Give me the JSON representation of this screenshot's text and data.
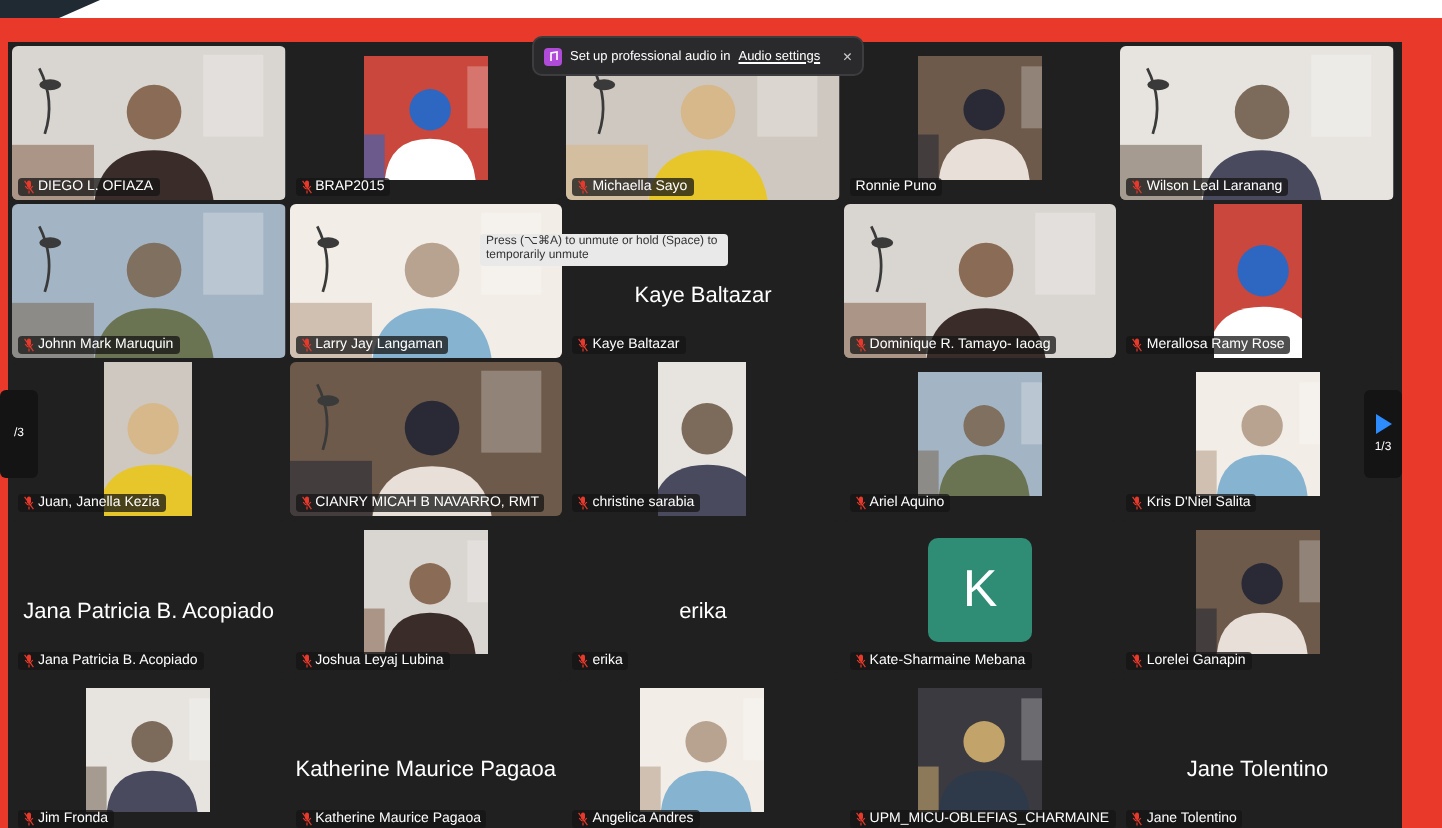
{
  "notification": {
    "text": "Set up professional audio in",
    "link": "Audio settings",
    "close": "×"
  },
  "tooltip": {
    "text": "Press (⌥⌘A) to unmute or hold (Space) to temporarily unmute"
  },
  "pager": {
    "prev": "/3",
    "next": "1/3"
  },
  "tiles": [
    {
      "kind": "video",
      "name": "DIEGO L. OFIAZA",
      "muted": true
    },
    {
      "kind": "square",
      "name": "BRAP2015",
      "muted": true
    },
    {
      "kind": "video",
      "name": "Michaella Sayo",
      "muted": true
    },
    {
      "kind": "square",
      "name": "Ronnie Puno",
      "muted": false
    },
    {
      "kind": "video",
      "name": "Wilson Leal Laranang",
      "muted": true
    },
    {
      "kind": "video",
      "name": "Johnn Mark Maruquin",
      "muted": true
    },
    {
      "kind": "video",
      "name": "Larry Jay Langaman",
      "muted": true
    },
    {
      "kind": "name",
      "name": "Kaye Baltazar",
      "muted": true,
      "display": "Kaye Baltazar"
    },
    {
      "kind": "video",
      "name": "Dominique R. Tamayo- Iaoag",
      "muted": true
    },
    {
      "kind": "portrait",
      "name": "Merallosa Ramy Rose",
      "muted": true
    },
    {
      "kind": "portrait",
      "name": "Juan, Janella Kezia",
      "muted": true
    },
    {
      "kind": "video",
      "name": "CIANRY MICAH B NAVARRO, RMT",
      "muted": true
    },
    {
      "kind": "portrait",
      "name": "christine sarabia",
      "muted": true
    },
    {
      "kind": "square",
      "name": "Ariel Aquino",
      "muted": true
    },
    {
      "kind": "square",
      "name": "Kris D'Niel Salita",
      "muted": true
    },
    {
      "kind": "name",
      "name": "Jana Patricia B. Acopiado",
      "muted": true,
      "display": "Jana Patricia B. Acopiado"
    },
    {
      "kind": "square",
      "name": "Joshua Leyaj Lubina",
      "muted": true
    },
    {
      "kind": "name",
      "name": "erika",
      "muted": true,
      "display": "erika"
    },
    {
      "kind": "letter",
      "name": "Kate-Sharmaine Mebana",
      "muted": true,
      "letter": "K"
    },
    {
      "kind": "square",
      "name": "Lorelei Ganapin",
      "muted": true
    },
    {
      "kind": "square",
      "name": "Jim Fronda",
      "muted": true
    },
    {
      "kind": "name",
      "name": "Katherine Maurice Pagaoa",
      "muted": true,
      "display": "Katherine Maurice Pagaoa"
    },
    {
      "kind": "square",
      "name": "Angelica Andres",
      "muted": true
    },
    {
      "kind": "square",
      "name": "UPM_MICU-OBLEFIAS_CHARMAINE",
      "muted": true
    },
    {
      "kind": "name",
      "name": "Jane Tolentino",
      "muted": true,
      "display": "Jane Tolentino"
    }
  ]
}
